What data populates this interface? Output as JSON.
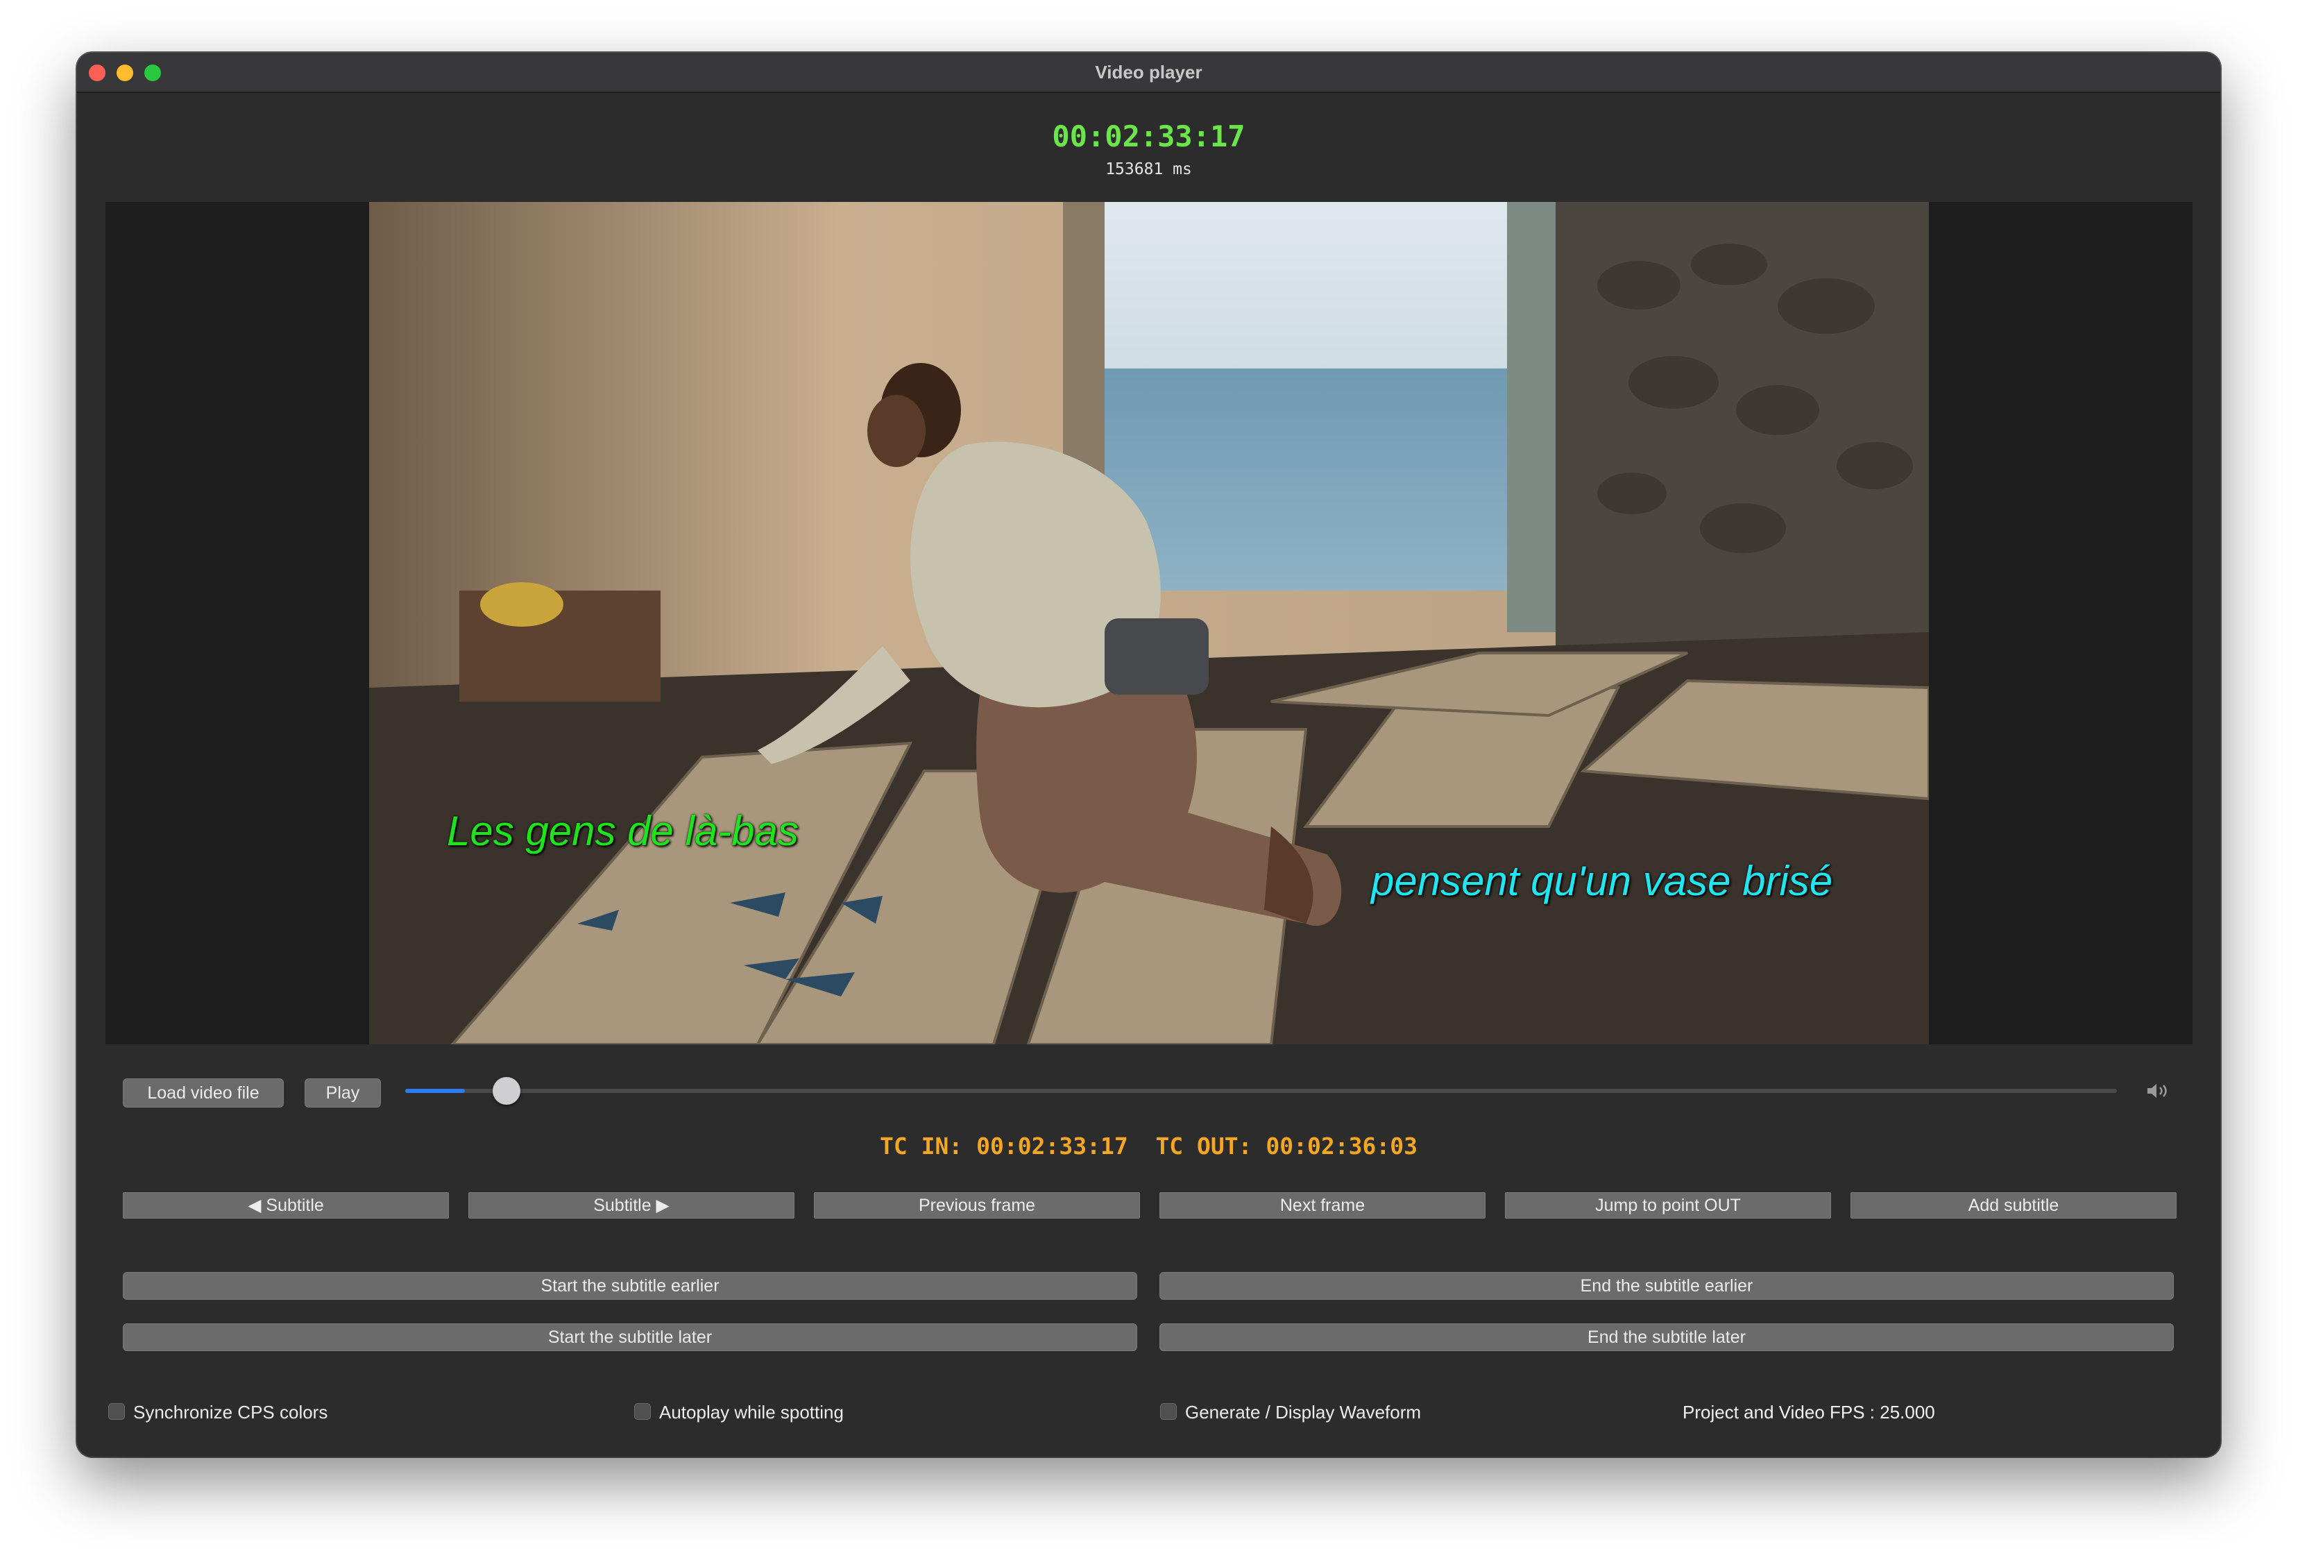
{
  "window": {
    "title": "Video player"
  },
  "timecode": {
    "current": "00:02:33:17",
    "milliseconds": "153681 ms"
  },
  "video": {
    "subtitle_left": "Les gens de là-bas",
    "subtitle_right": "pensent qu'un vase brisé",
    "colors": {
      "subtitle_left": "#1ee41e",
      "subtitle_right": "#1fe6f0"
    }
  },
  "controls": {
    "load_label": "Load video file",
    "play_label": "Play",
    "position_fraction": 0.035,
    "volume_icon": "speaker-icon"
  },
  "tc_in_out": {
    "in_label": "TC IN:",
    "in_value": "00:02:33:17",
    "out_label": "TC OUT:",
    "out_value": "00:02:36:03"
  },
  "nav_buttons": {
    "prev_subtitle": "◀ Subtitle",
    "next_subtitle": "Subtitle ▶",
    "previous_frame": "Previous frame",
    "next_frame": "Next frame",
    "jump_out": "Jump to point OUT",
    "add_subtitle": "Add subtitle"
  },
  "adjust_buttons": {
    "start_earlier": "Start the subtitle earlier",
    "end_earlier": "End the subtitle earlier",
    "start_later": "Start the subtitle later",
    "end_later": "End the subtitle later"
  },
  "options": {
    "sync_cps": "Synchronize CPS colors",
    "autoplay": "Autoplay while spotting",
    "waveform": "Generate / Display Waveform",
    "fps": "Project and Video FPS : 25.000"
  },
  "accent_colors": {
    "timecode": "#6be64a",
    "tc_in_out": "#f5a623",
    "slider": "#2d7bf5"
  }
}
